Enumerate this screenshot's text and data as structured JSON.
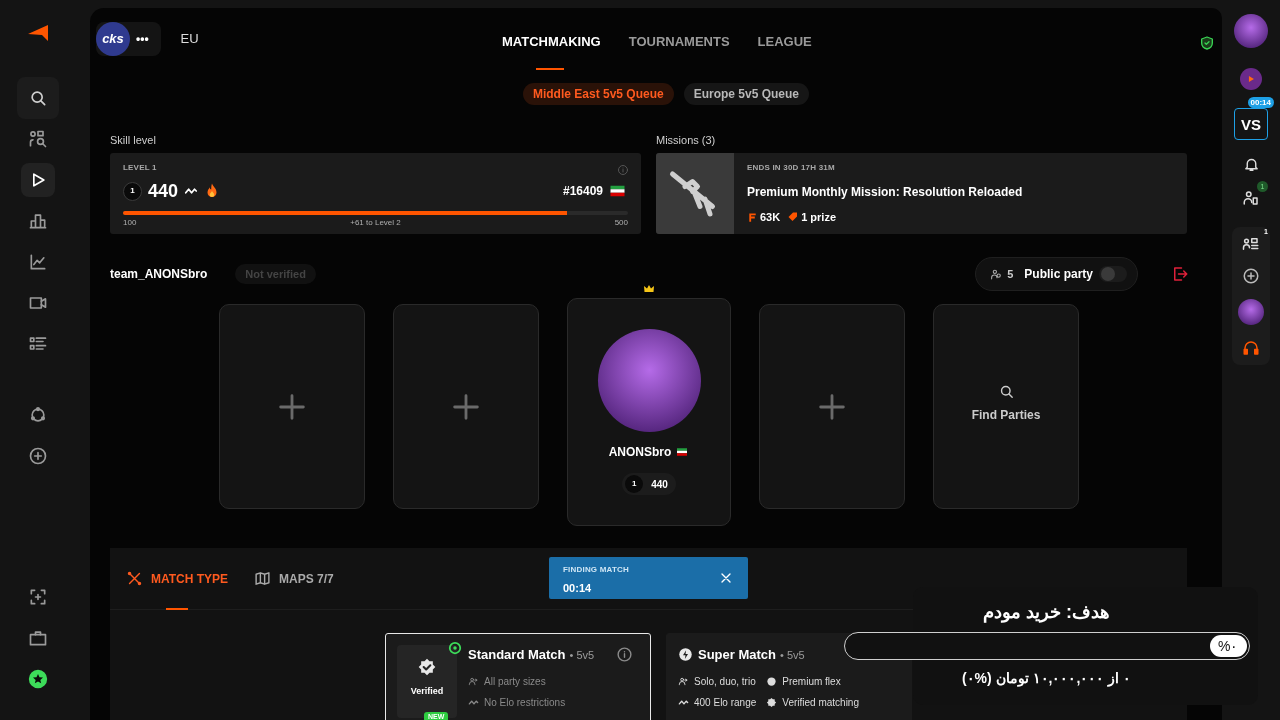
{
  "sidebar_nav": [
    {
      "kind": "search",
      "selected": false
    },
    {
      "kind": "find-players",
      "selected": false
    },
    {
      "kind": "play",
      "selected": true
    },
    {
      "kind": "bar-chart",
      "selected": false
    },
    {
      "kind": "line-chart",
      "selected": false
    },
    {
      "kind": "video",
      "selected": false
    },
    {
      "kind": "list",
      "selected": false
    },
    {
      "kind": "network",
      "selected": false
    },
    {
      "kind": "plus",
      "selected": false
    },
    {
      "kind": "capture",
      "selected": false
    },
    {
      "kind": "briefcase",
      "selected": false
    },
    {
      "kind": "star",
      "selected": false
    }
  ],
  "header": {
    "logo": "cks",
    "more": "•••",
    "region": "EU"
  },
  "nav_tabs": [
    {
      "label": "MATCHMAKING",
      "selected": true
    },
    {
      "label": "TOURNAMENTS",
      "selected": false
    },
    {
      "label": "LEAGUE",
      "selected": false
    }
  ],
  "queues": [
    {
      "label": "Middle East 5v5 Queue",
      "selected": true
    },
    {
      "label": "Europe 5v5 Queue",
      "selected": false
    }
  ],
  "skill": {
    "heading": "Skill level",
    "level_label": "LEVEL 1",
    "badge": "1",
    "elo": "440",
    "rank": "#16409",
    "level": 0.88,
    "min": "100",
    "progress_text": "+61 to Level 2",
    "max": "500"
  },
  "missions": {
    "heading": "Missions (3)",
    "ends": "ENDS IN 30D 17H 31M",
    "title": "Premium Monthly Mission: Resolution Reloaded",
    "points": "63K",
    "prize": "1 prize"
  },
  "party": {
    "team": "team_ANONSbro",
    "verified_label": "Not verified",
    "count": "5",
    "visibility": "Public party",
    "public_on": false
  },
  "slots": [
    {
      "kind": "empty"
    },
    {
      "kind": "empty"
    },
    {
      "kind": "player",
      "name": "ANONSbro",
      "badge": "1",
      "elo": "440",
      "leader": true
    },
    {
      "kind": "empty"
    },
    {
      "kind": "find",
      "label": "Find Parties"
    }
  ],
  "match_tabs": [
    {
      "label": "MATCH TYPE",
      "selected": true
    },
    {
      "label": "MAPS 7/7",
      "selected": false
    }
  ],
  "finding": {
    "label": "FINDING MATCH",
    "time": "00:14"
  },
  "match_types": [
    {
      "title": "Standard Match",
      "mode": "• 5v5",
      "selected": true,
      "badge": "Verified",
      "new_badge": "NEW",
      "features": [
        "All party sizes",
        "No Elo restrictions"
      ]
    },
    {
      "title": "Super Match",
      "mode": "• 5v5",
      "selected": false,
      "features": [
        "Solo, duo, trio",
        "Premium flex",
        "400 Elo range",
        "Verified matching"
      ]
    }
  ],
  "right_sidebar": {
    "vs": "VS",
    "vs_timer": "00:14",
    "friends_badge": "1",
    "party_badge": "1"
  },
  "goal": {
    "title": "هدف: خرید مودم",
    "percent": "%۰",
    "level": 0,
    "amount": "۰ از ۱۰,۰۰۰,۰۰۰ تومان (%۰)"
  }
}
